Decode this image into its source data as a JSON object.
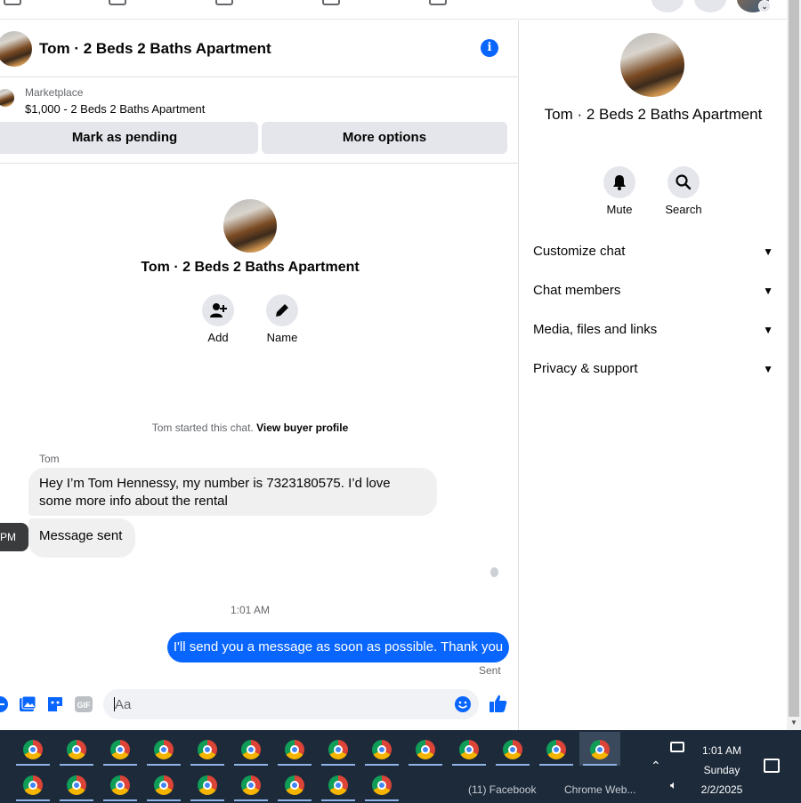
{
  "conversation": {
    "title": "Tom · 2 Beds 2 Baths Apartment"
  },
  "marketplace": {
    "label": "Marketplace",
    "listing": "$1,000 - 2 Beds 2 Baths Apartment",
    "mark_pending_label": "Mark as pending",
    "more_options_label": "More options"
  },
  "intro": {
    "title": "Tom · 2 Beds 2 Baths Apartment",
    "add_label": "Add",
    "name_label": "Name",
    "started_text": "Tom started this chat.",
    "buyer_profile_link": "View buyer profile"
  },
  "messages": {
    "sender_name": "Tom",
    "incoming": [
      "Hey I’m Tom Hennessy, my number is 7323180575. I’d love some more info about the rental",
      "Message sent"
    ],
    "hover_time": "PM",
    "timestamp": "1:01 AM",
    "outgoing": "I'll send you a message as soon as possible. Thank you",
    "status": "Sent"
  },
  "composer": {
    "placeholder": "Aa"
  },
  "right_panel": {
    "title": "Tom · 2 Beds 2 Baths Apartment",
    "mute_label": "Mute",
    "search_label": "Search",
    "sections": [
      "Customize chat",
      "Chat members",
      "Media, files and links",
      "Privacy & support"
    ]
  },
  "taskbar": {
    "window_labels": [
      "(11) Facebook",
      "Chrome Web..."
    ],
    "clock_time": "1:01 AM",
    "clock_day": "Sunday",
    "clock_date": "2/2/2025"
  },
  "colors": {
    "accent_blue": "#0866ff",
    "bubble_gray": "#f0f0f0",
    "taskbar_bg": "#1c2a3a"
  }
}
